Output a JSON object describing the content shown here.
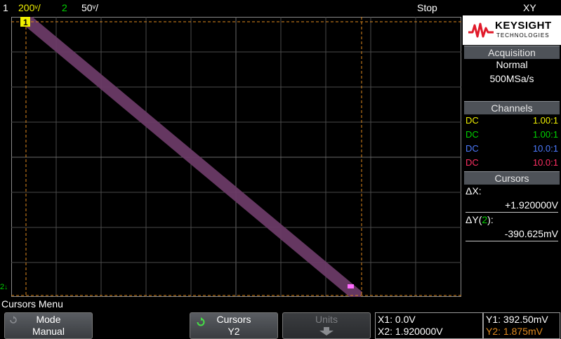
{
  "status_bar": {
    "ch1_num": "1",
    "ch1_scale": "200ᵛ/",
    "ch2_num": "2",
    "ch2_scale": "50ᵛ/",
    "run_state": "Stop",
    "mode": "XY"
  },
  "brand": {
    "name": "KEYSIGHT",
    "sub": "TECHNOLOGIES"
  },
  "acquisition": {
    "title": "Acquisition",
    "mode": "Normal",
    "rate": "500MSa/s"
  },
  "channels": {
    "title": "Channels",
    "rows": [
      {
        "coupling": "DC",
        "ratio": "1.00:1",
        "color": "#f0f000"
      },
      {
        "coupling": "DC",
        "ratio": "1.00:1",
        "color": "#00d200"
      },
      {
        "coupling": "DC",
        "ratio": "10.0:1",
        "color": "#4d7bff"
      },
      {
        "coupling": "DC",
        "ratio": "10.0:1",
        "color": "#ff2f63"
      }
    ]
  },
  "cursors_panel": {
    "title": "Cursors",
    "dx_label": "ΔX:",
    "dx_value": "+1.920000V",
    "dy_label_prefix": "ΔY(",
    "dy_channel": "2",
    "dy_label_suffix": "):",
    "dy_value": "-390.625mV"
  },
  "markers": {
    "ch1": "1",
    "ch2": "2"
  },
  "menu": {
    "title": "Cursors Menu",
    "softkeys": [
      {
        "top": "Mode",
        "bottom": "Manual"
      },
      {
        "top": "Cursors",
        "bottom": "Y2"
      },
      {
        "top": "Units",
        "bottom": ""
      }
    ]
  },
  "readout": {
    "x1": "X1: 0.0V",
    "x2": "X2: 1.920000V",
    "y1": "Y1: 392.50mV",
    "y2": "Y2: 1.875mV"
  },
  "colors": {
    "trace": "#6a3a66",
    "cursor": "#e08a1e",
    "grid": "#555555",
    "marker": "#ff6bff"
  }
}
